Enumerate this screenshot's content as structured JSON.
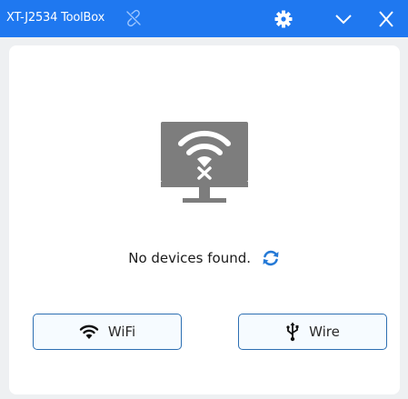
{
  "window": {
    "title": "XT-J2534 ToolBox",
    "title_icon": "unlinked-chain-icon",
    "buttons": [
      "settings-icon",
      "chevron-down-icon",
      "close-icon"
    ]
  },
  "colors": {
    "titlebar": "#1f78f0",
    "accent": "#2d6fb2",
    "device_icon": "#7d7d7d",
    "refresh_icon": "#2479d6"
  },
  "status": {
    "device_icon": "monitor-wifi-disconnected-icon",
    "message": "No devices found."
  },
  "actions": {
    "wifi": {
      "label": "WiFi",
      "icon": "wifi-icon"
    },
    "wire": {
      "label": "Wire",
      "icon": "usb-icon"
    }
  }
}
